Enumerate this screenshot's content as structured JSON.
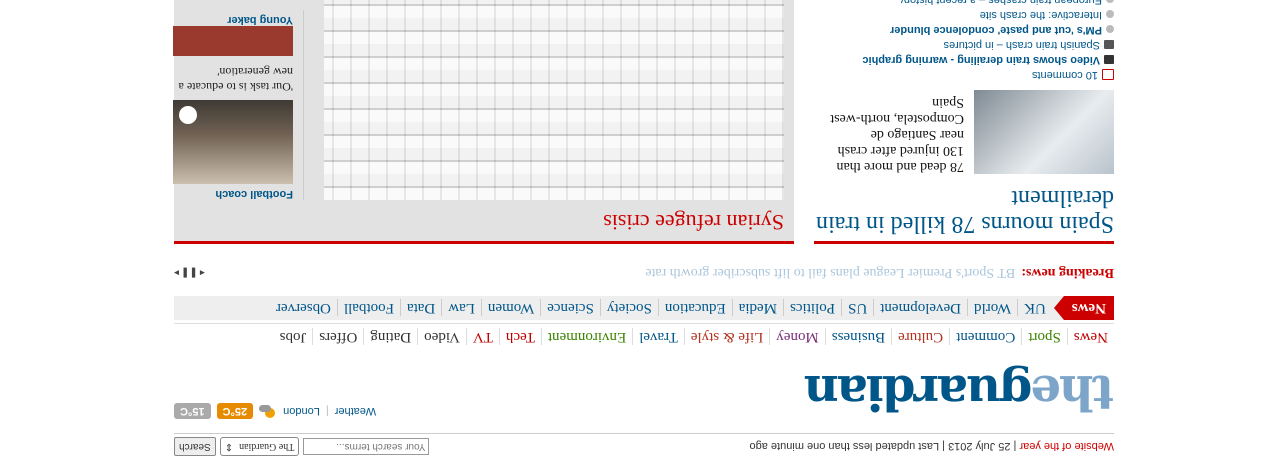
{
  "topbar": {
    "website_of_year": "Website of the year",
    "date_text": " | 25 July 2013 | Last updated less than one minute ago",
    "search_placeholder": "Your search terms...",
    "search_scope": "The Guardian",
    "search_button": "Search"
  },
  "logo": {
    "the": "the",
    "guardian": "guardian"
  },
  "weather": {
    "label": "Weather",
    "location": "London",
    "high": "25°C",
    "low": "15°C"
  },
  "sections": [
    {
      "label": "News",
      "color": "#c00000"
    },
    {
      "label": "Sport",
      "color": "#3b8300"
    },
    {
      "label": "Comment",
      "color": "#005689"
    },
    {
      "label": "Culture",
      "color": "#b4301d"
    },
    {
      "label": "Business",
      "color": "#005689"
    },
    {
      "label": "Money",
      "color": "#7b2d78"
    },
    {
      "label": "Life & style",
      "color": "#b4301d"
    },
    {
      "label": "Travel",
      "color": "#005689"
    },
    {
      "label": "Environment",
      "color": "#3b8300"
    },
    {
      "label": "Tech",
      "color": "#c00000"
    },
    {
      "label": "TV",
      "color": "#c00000"
    },
    {
      "label": "Video",
      "color": "#333333"
    },
    {
      "label": "Dating",
      "color": "#333333"
    },
    {
      "label": "Offers",
      "color": "#333333"
    },
    {
      "label": "Jobs",
      "color": "#333333"
    }
  ],
  "subnav": {
    "active": "News",
    "items": [
      "UK",
      "World",
      "Development",
      "US",
      "Politics",
      "Media",
      "Education",
      "Society",
      "Science",
      "Women",
      "Law",
      "Data",
      "Football",
      "Observer"
    ]
  },
  "breaking": {
    "label": "Breaking news:",
    "text": "BT Sport's Premier League plans fail to lift subscriber growth rate"
  },
  "lead": {
    "headline": "Spain mourns 78 killed in train derailment",
    "standfirst": "78 dead and more than 130 injured after crash near Santiago de Compostela, north-west Spain",
    "comments": "10 comments",
    "links": [
      {
        "text": "Video shows train derailing - warning graphic",
        "bold": true,
        "icon": "video-icon"
      },
      {
        "text": "Spanish train crash – in pictures",
        "bold": false,
        "icon": "camera-icon"
      },
      {
        "text": "PM's 'cut and paste' condolence blunder",
        "bold": true,
        "icon": "dot-icon"
      },
      {
        "text": "Interactive: the crash site",
        "bold": false,
        "icon": "interactive-icon"
      },
      {
        "text": "European train crashes – a recent history",
        "bold": false,
        "icon": "dot-icon"
      }
    ]
  },
  "syria": {
    "headline": "Syrian refugee crisis",
    "side_kicker": "Football coach",
    "side_quote": "'Our task is to educate a new generation'",
    "side_kicker2": "Young baker"
  }
}
